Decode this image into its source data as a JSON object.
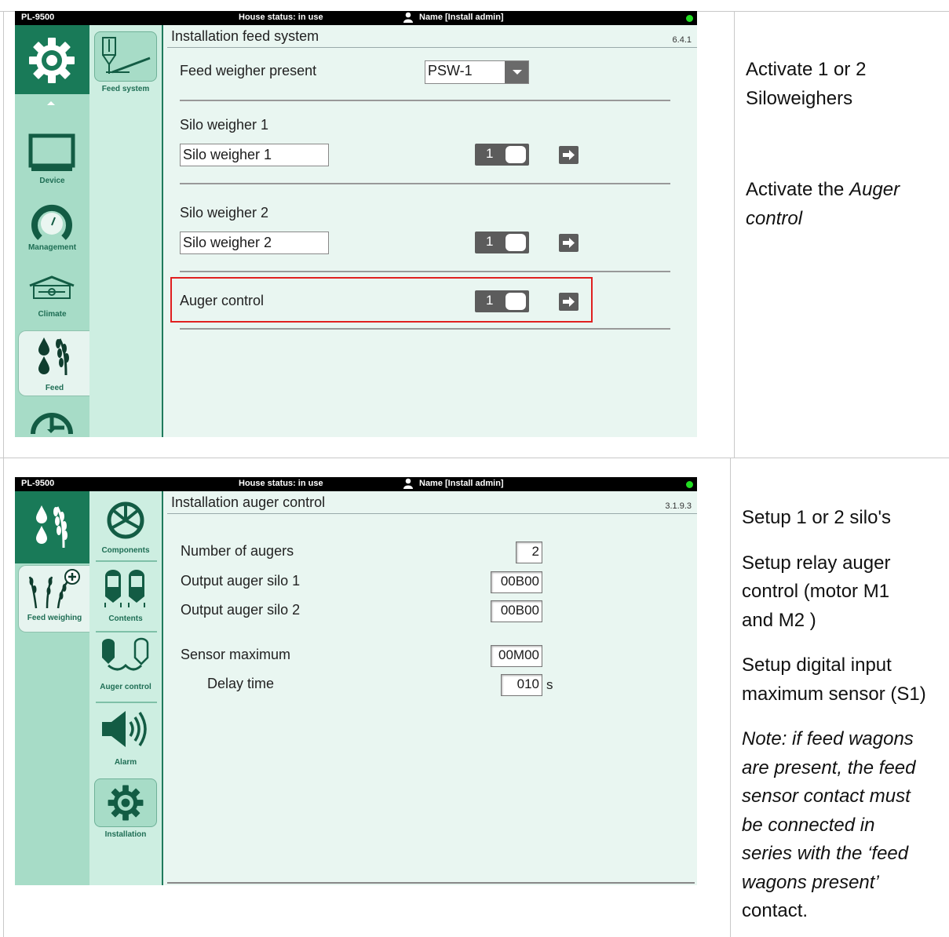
{
  "screen1": {
    "model": "PL-9500",
    "house_status": "House status: in use",
    "user": "Name [Install admin]",
    "nav": {
      "device": "Device",
      "management": "Management",
      "climate": "Climate",
      "feed": "Feed"
    },
    "sub": {
      "feed_system": "Feed system"
    },
    "title": "Installation feed system",
    "code": "6.4.1",
    "feed_weigher_label": "Feed weigher present",
    "feed_weigher_value": "PSW-1",
    "silo1_label": "Silo weigher 1",
    "silo1_field": "Silo weigher 1",
    "silo1_toggle": "1",
    "silo2_label": "Silo weigher 2",
    "silo2_field": "Silo weigher 2",
    "silo2_toggle": "1",
    "auger_label": "Auger control",
    "auger_toggle": "1"
  },
  "screen2": {
    "model": "PL-9500",
    "house_status": "House status: in use",
    "user": "Name [Install admin]",
    "nav": {
      "feed_weighing": "Feed weighing"
    },
    "sub": {
      "components": "Components",
      "contents": "Contents",
      "auger_control": "Auger control",
      "alarm": "Alarm",
      "installation": "Installation"
    },
    "title": "Installation auger control",
    "code": "3.1.9.3",
    "rows": {
      "num_augers_label": "Number of augers",
      "num_augers_value": "2",
      "out1_label": "Output auger silo 1",
      "out1_value": "00B00",
      "out2_label": "Output auger silo 2",
      "out2_value": "00B00",
      "sensor_label": "Sensor maximum",
      "sensor_value": "00M00",
      "delay_label": "Delay time",
      "delay_value": "010",
      "delay_unit": "s"
    }
  },
  "notes1": {
    "a1": "Activate 1 or 2",
    "a2": "Siloweighers",
    "b1": "Activate the ",
    "b1_i": "Auger",
    "b2_i": "control"
  },
  "notes2": {
    "p1": "Setup 1 or 2 silo's",
    "p2a": "Setup relay auger",
    "p2b": "control  (motor M1",
    "p2c": "and M2 )",
    "p3a": "Setup digital input",
    "p3b": "maximum sensor (S1)",
    "n1": "Note: if feed wagons",
    "n2": "are present, the feed",
    "n3": "sensor contact must",
    "n4": "be connected in",
    "n5": "series with the ‘feed",
    "n6": "wagons present’",
    "n7": "contact."
  },
  "colors": {
    "accent_dark": "#197a58",
    "nav_bg": "#a7dcc7",
    "highlight": "#e02020"
  }
}
